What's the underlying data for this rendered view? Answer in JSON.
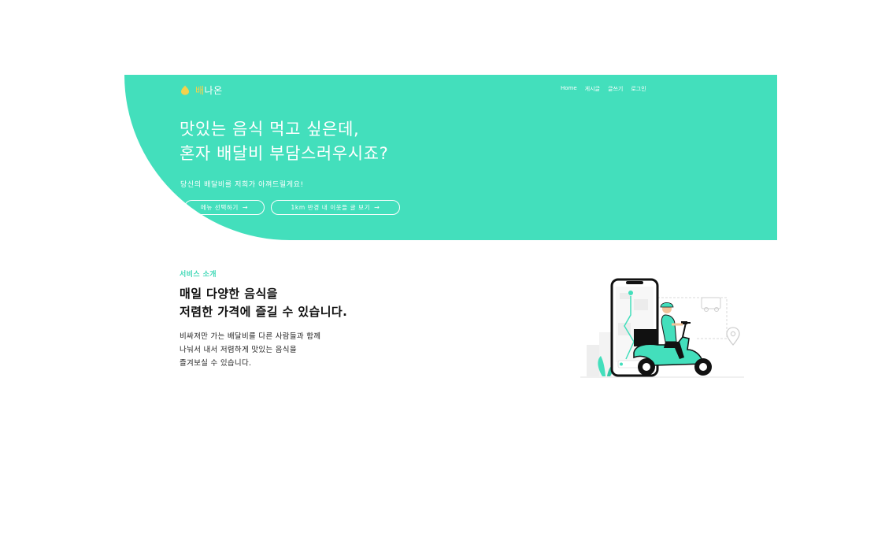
{
  "brand": {
    "highlight": "배",
    "rest": "나온"
  },
  "nav": {
    "items": [
      "Home",
      "게시글",
      "글쓰기",
      "로그인"
    ]
  },
  "hero": {
    "title_line1": "맛있는 음식 먹고 싶은데,",
    "title_line2": "혼자 배달비 부담스러우시죠?",
    "subtitle": "당신의 배달비를 저희가 아껴드릴게요!",
    "btn_menu": "메뉴 선택하기",
    "btn_nearby": "1km 반경 내 이웃들 글 보기",
    "arrow": "→"
  },
  "service": {
    "eyebrow": "서비스 소개",
    "title_line1": "매일 다양한 음식을",
    "title_line2": "저렴한 가격에 즐길 수 있습니다.",
    "desc_line1": "비싸져만 가는 배달비를 다른 사람들과 함께",
    "desc_line2": "나눠서 내서 저렴하게 맛있는 음식을",
    "desc_line3": "즐겨보실 수 있습니다."
  },
  "colors": {
    "brand": "#43dfbc",
    "accent": "#f3d24c"
  },
  "icons": {
    "logo": "drop-icon",
    "illustration": "delivery-scooter-illustration"
  }
}
